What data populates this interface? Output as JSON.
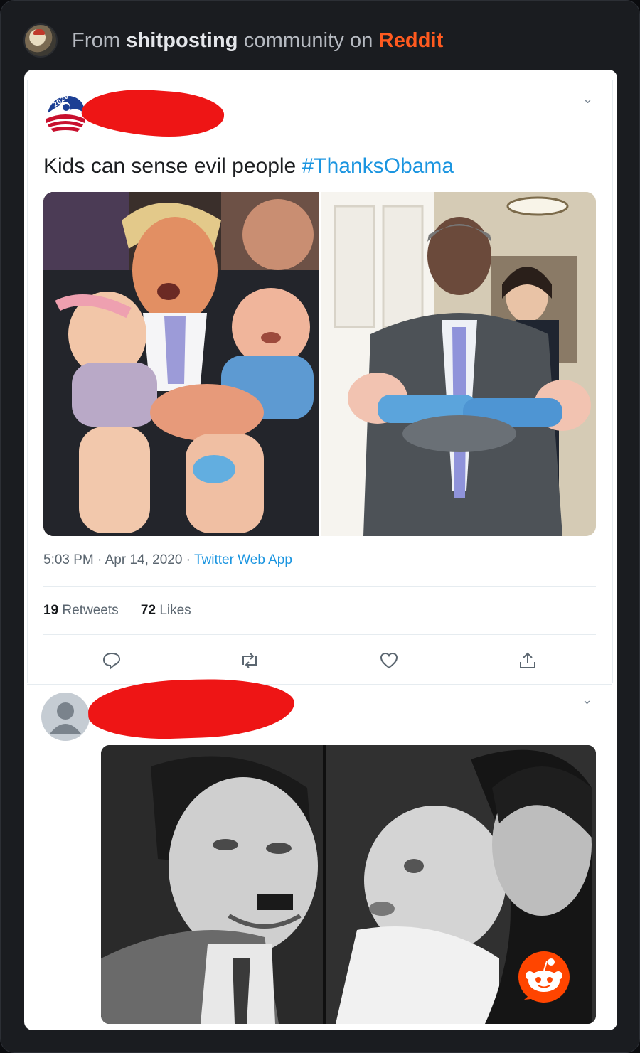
{
  "header": {
    "prefix": "From",
    "community": "shitposting",
    "middle": "community on",
    "platform": "Reddit"
  },
  "tweet1": {
    "text": "Kids can sense evil people",
    "hashtag": "#ThanksObama",
    "time": "5:03 PM · Apr 14, 2020 ·",
    "via": "Twitter Web App",
    "retweets_count": "19",
    "retweets_label": "Retweets",
    "likes_count": "72",
    "likes_label": "Likes"
  },
  "icons": [
    "chevron-down-icon",
    "reply-icon",
    "retweet-icon",
    "like-icon",
    "share-icon",
    "avatar-placeholder-icon",
    "reddit-snoo-icon"
  ],
  "colors": {
    "brand_reddit": "#ff5a1f",
    "twitter_blue": "#1b95e0",
    "redaction": "#ee1515",
    "background": "#1a1c20"
  }
}
